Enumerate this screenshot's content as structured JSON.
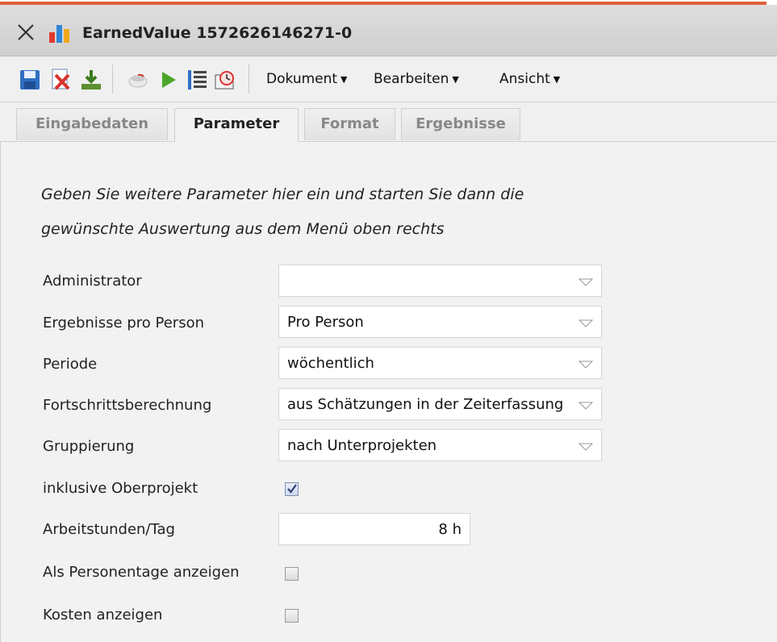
{
  "window": {
    "title": "EarnedValue 1572626146271-0"
  },
  "toolbar": {
    "icons": [
      "save-icon",
      "delete-icon",
      "download-icon",
      "coffee-icon",
      "run-icon",
      "list-icon",
      "schedule-icon"
    ],
    "menus": [
      {
        "label": "Dokument"
      },
      {
        "label": "Bearbeiten"
      },
      {
        "label": "Ansicht"
      }
    ]
  },
  "tabs": [
    {
      "label": "Eingabedaten",
      "active": false
    },
    {
      "label": "Parameter",
      "active": true
    },
    {
      "label": "Format",
      "active": false
    },
    {
      "label": "Ergebnisse",
      "active": false
    }
  ],
  "form": {
    "intro_line1": "Geben Sie weitere Parameter hier ein und starten Sie dann die",
    "intro_line2": "gewünschte Auswertung aus dem Menü oben rechts",
    "administrator": {
      "label": "Administrator",
      "value": ""
    },
    "ergebnisse": {
      "label": "Ergebnisse pro Person",
      "value": "Pro Person"
    },
    "periode": {
      "label": "Periode",
      "value": "wöchentlich"
    },
    "fortschritt": {
      "label": "Fortschrittsberechnung",
      "value": "aus Schätzungen in der Zeiterfassung"
    },
    "gruppierung": {
      "label": "Gruppierung",
      "value": "nach Unterprojekten"
    },
    "oberprojekt": {
      "label": "inklusive Oberprojekt",
      "checked": true
    },
    "arbeitsstunden": {
      "label": "Arbeitstunden/Tag",
      "value": "8 h"
    },
    "personentage": {
      "label": "Als Personentage anzeigen",
      "checked": false
    },
    "kosten": {
      "label": "Kosten anzeigen",
      "checked": false
    }
  },
  "colors": {
    "accent": "#e0603c",
    "titlebar": "#d6d6d6",
    "background": "#f2f2f2"
  }
}
